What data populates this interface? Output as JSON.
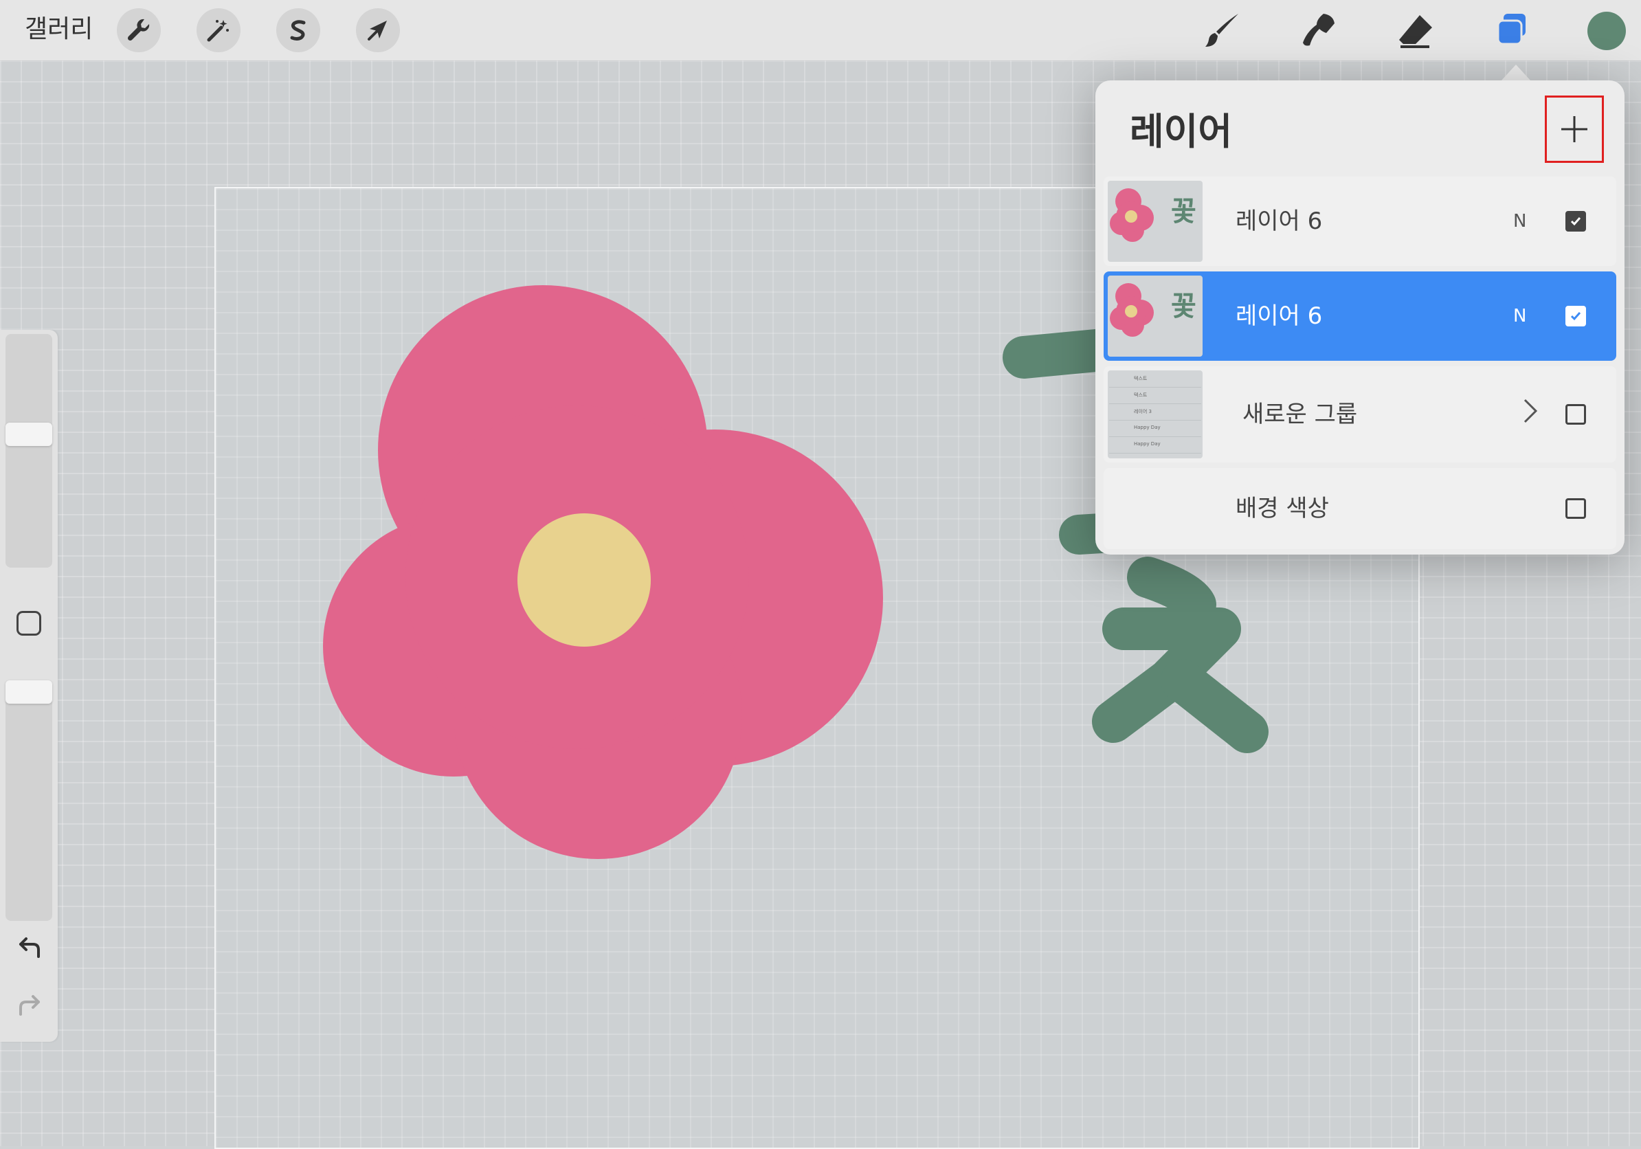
{
  "toolbar": {
    "gallery_label": "갤러리",
    "left_tools": [
      {
        "name": "actions",
        "icon": "wrench-icon"
      },
      {
        "name": "adjustments",
        "icon": "magic-wand-icon"
      },
      {
        "name": "selection",
        "icon": "selection-s-icon"
      },
      {
        "name": "transform",
        "icon": "arrow-cursor-icon"
      }
    ],
    "right_tools": [
      {
        "name": "brush",
        "icon": "brush-icon"
      },
      {
        "name": "smudge",
        "icon": "smudge-icon"
      },
      {
        "name": "eraser",
        "icon": "eraser-icon"
      },
      {
        "name": "layers",
        "icon": "layers-icon",
        "active": true
      }
    ],
    "current_color": "#5f8873"
  },
  "sidebar": {
    "brush_size_level": 0.43,
    "opacity_level": 0.05,
    "undo_icon": "undo-icon",
    "redo_icon": "redo-icon"
  },
  "layers_panel": {
    "title": "레이어",
    "add_icon": "plus-icon",
    "layers": [
      {
        "name": "레이어 6",
        "blend_mode": "N",
        "visible": true,
        "selected": false,
        "thumb_text": "꽃"
      },
      {
        "name": "레이어 6",
        "blend_mode": "N",
        "visible": true,
        "selected": true,
        "thumb_text": "꽃"
      },
      {
        "name": "새로운 그룹",
        "type": "group",
        "visible": false,
        "selected": false,
        "thumb_rows": [
          "텍스트",
          "텍스트",
          "레이어 3",
          "Happy Day",
          "Happy Day"
        ]
      },
      {
        "name": "배경 색상",
        "type": "background",
        "visible": false,
        "selected": false
      }
    ]
  },
  "colors": {
    "petal": "#e1658c",
    "flower_center": "#e8d28e",
    "stroke": "#5d8672",
    "selection_blue": "#3d8bf4"
  }
}
